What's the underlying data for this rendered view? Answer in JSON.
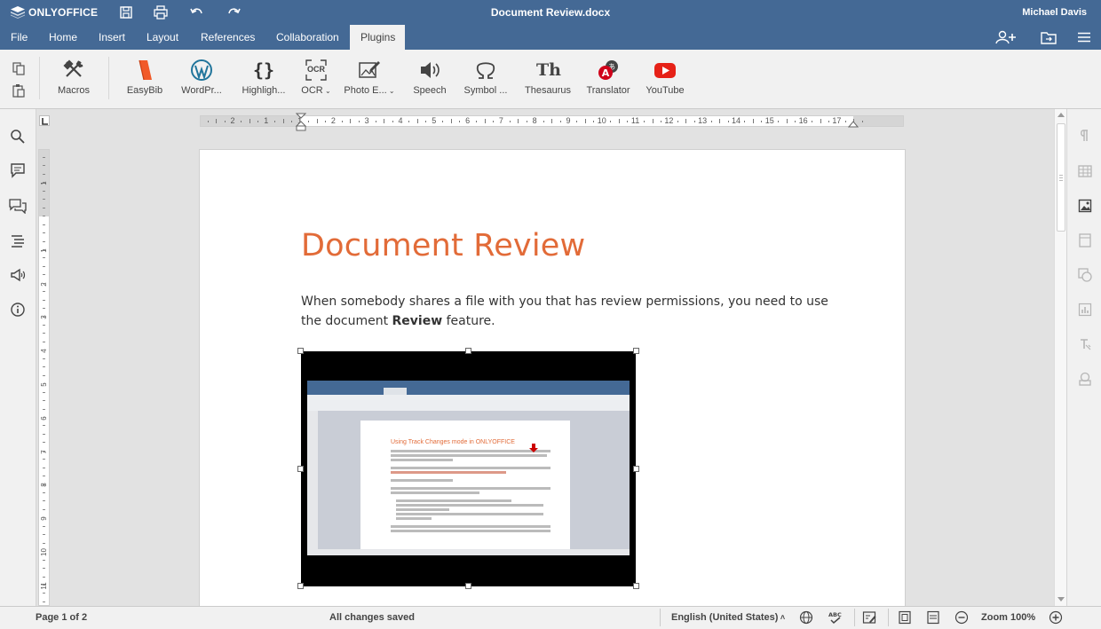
{
  "app": {
    "brand": "ONLYOFFICE",
    "doc_title": "Document Review.docx",
    "user": "Michael Davis"
  },
  "menu": {
    "tabs": [
      "File",
      "Home",
      "Insert",
      "Layout",
      "References",
      "Collaboration",
      "Plugins"
    ],
    "active": "Plugins"
  },
  "toolbar": {
    "tools": [
      {
        "label": "Macros",
        "icon": "macros-icon"
      },
      {
        "label": "EasyBib",
        "icon": "easybib-icon"
      },
      {
        "label": "WordPr...",
        "icon": "wordpress-icon"
      },
      {
        "label": "Highligh...",
        "icon": "braces-icon"
      },
      {
        "label": "OCR",
        "icon": "ocr-icon"
      },
      {
        "label": "Photo E...",
        "icon": "photo-editor-icon"
      },
      {
        "label": "Speech",
        "icon": "speaker-icon"
      },
      {
        "label": "Symbol ...",
        "icon": "omega-icon"
      },
      {
        "label": "Thesaurus",
        "icon": "thesaurus-icon"
      },
      {
        "label": "Translator",
        "icon": "translator-icon"
      },
      {
        "label": "YouTube",
        "icon": "youtube-icon"
      }
    ],
    "ocr_glyph": "OCR",
    "thesaurus_glyph": "Th",
    "braces_glyph": "{}"
  },
  "ruler": {
    "marks": [
      "2",
      "1",
      "1",
      "2",
      "3",
      "4",
      "5",
      "6",
      "7",
      "8",
      "9",
      "10",
      "11",
      "12",
      "13",
      "14",
      "15",
      "16",
      "17"
    ]
  },
  "vruler": {
    "marks": [
      "1",
      "1",
      "2",
      "3",
      "4",
      "5",
      "6",
      "7",
      "8",
      "9",
      "10",
      "11"
    ]
  },
  "document": {
    "heading": "Document Review",
    "para_before": "When somebody shares a file with you that has review permissions, you need to use the document ",
    "para_bold": "Review",
    "para_after": " feature."
  },
  "embedded_shot": {
    "heading": "Using Track Changes mode in ONLYOFFICE"
  },
  "status": {
    "page": "Page 1 of 2",
    "saved": "All changes saved",
    "language": "English (United States)",
    "zoom": "Zoom 100%"
  },
  "colors": {
    "brand": "#446995",
    "heading": "#e26b38",
    "youtube": "#e62117",
    "easybib": "#f15a29",
    "translator": "#d0021b"
  }
}
